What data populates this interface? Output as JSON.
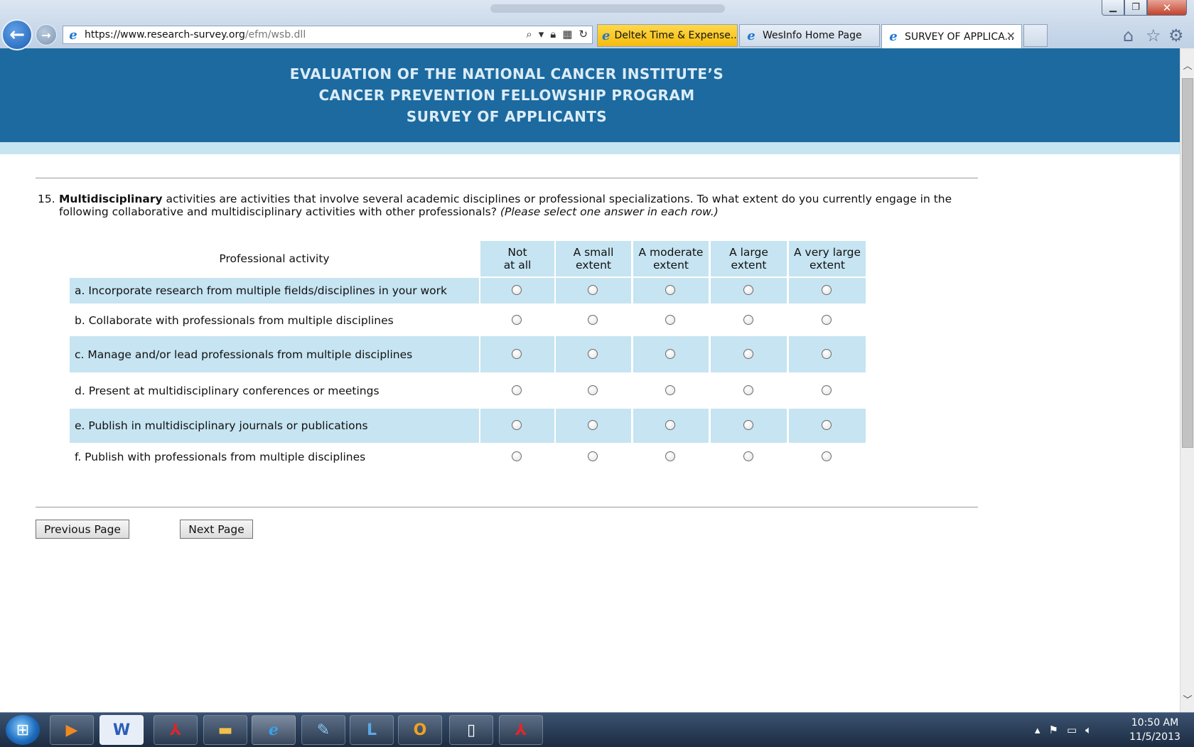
{
  "browser": {
    "url_host": "https://www.research-survey.org",
    "url_path": "/efm/wsb.dll",
    "tabs": [
      {
        "label": "Deltek Time & Expense..."
      },
      {
        "label": "WesInfo Home Page"
      },
      {
        "label": "SURVEY OF APPLICA..."
      }
    ]
  },
  "header": {
    "line1": "EVALUATION OF THE NATIONAL CANCER INSTITUTE’S",
    "line2": "CANCER PREVENTION FELLOWSHIP PROGRAM",
    "line3": "SURVEY OF APPLICANTS"
  },
  "question": {
    "number": "15.",
    "bold_term": "Multidisciplinary",
    "text": " activities are activities that involve several academic disciplines or professional specializations. To what extent do you currently engage in the following collaborative and multidisciplinary activities with other professionals? ",
    "hint": "(Please select one answer in each row.)"
  },
  "grid": {
    "activity_header": "Professional activity",
    "columns": [
      {
        "line1": "Not",
        "line2": "at all"
      },
      {
        "line1": "A small",
        "line2": "extent"
      },
      {
        "line1": "A moderate",
        "line2": "extent"
      },
      {
        "line1": "A large",
        "line2": "extent"
      },
      {
        "line1": "A very large",
        "line2": "extent"
      }
    ],
    "rows": [
      {
        "label": "a. Incorporate research from multiple fields/disciplines in your work"
      },
      {
        "label": "b. Collaborate with professionals from multiple disciplines"
      },
      {
        "label": "c. Manage and/or lead professionals from multiple disciplines"
      },
      {
        "label": "d. Present at multidisciplinary conferences or meetings"
      },
      {
        "label": "e. Publish in multidisciplinary journals or publications"
      },
      {
        "label": "f. Publish with professionals from multiple disciplines"
      }
    ]
  },
  "nav": {
    "previous_label": "Previous Page",
    "next_label": "Next Page"
  },
  "taskbar": {
    "time": "10:50 AM",
    "date": "11/5/2013",
    "items": [
      "media-player",
      "word",
      "acrobat",
      "explorer",
      "internet-explorer",
      "notepad",
      "lync",
      "outlook",
      "blank-document",
      "pdf"
    ]
  },
  "colors": {
    "header_band": "#1c6a9f",
    "row_shade": "#c6e4f1"
  }
}
